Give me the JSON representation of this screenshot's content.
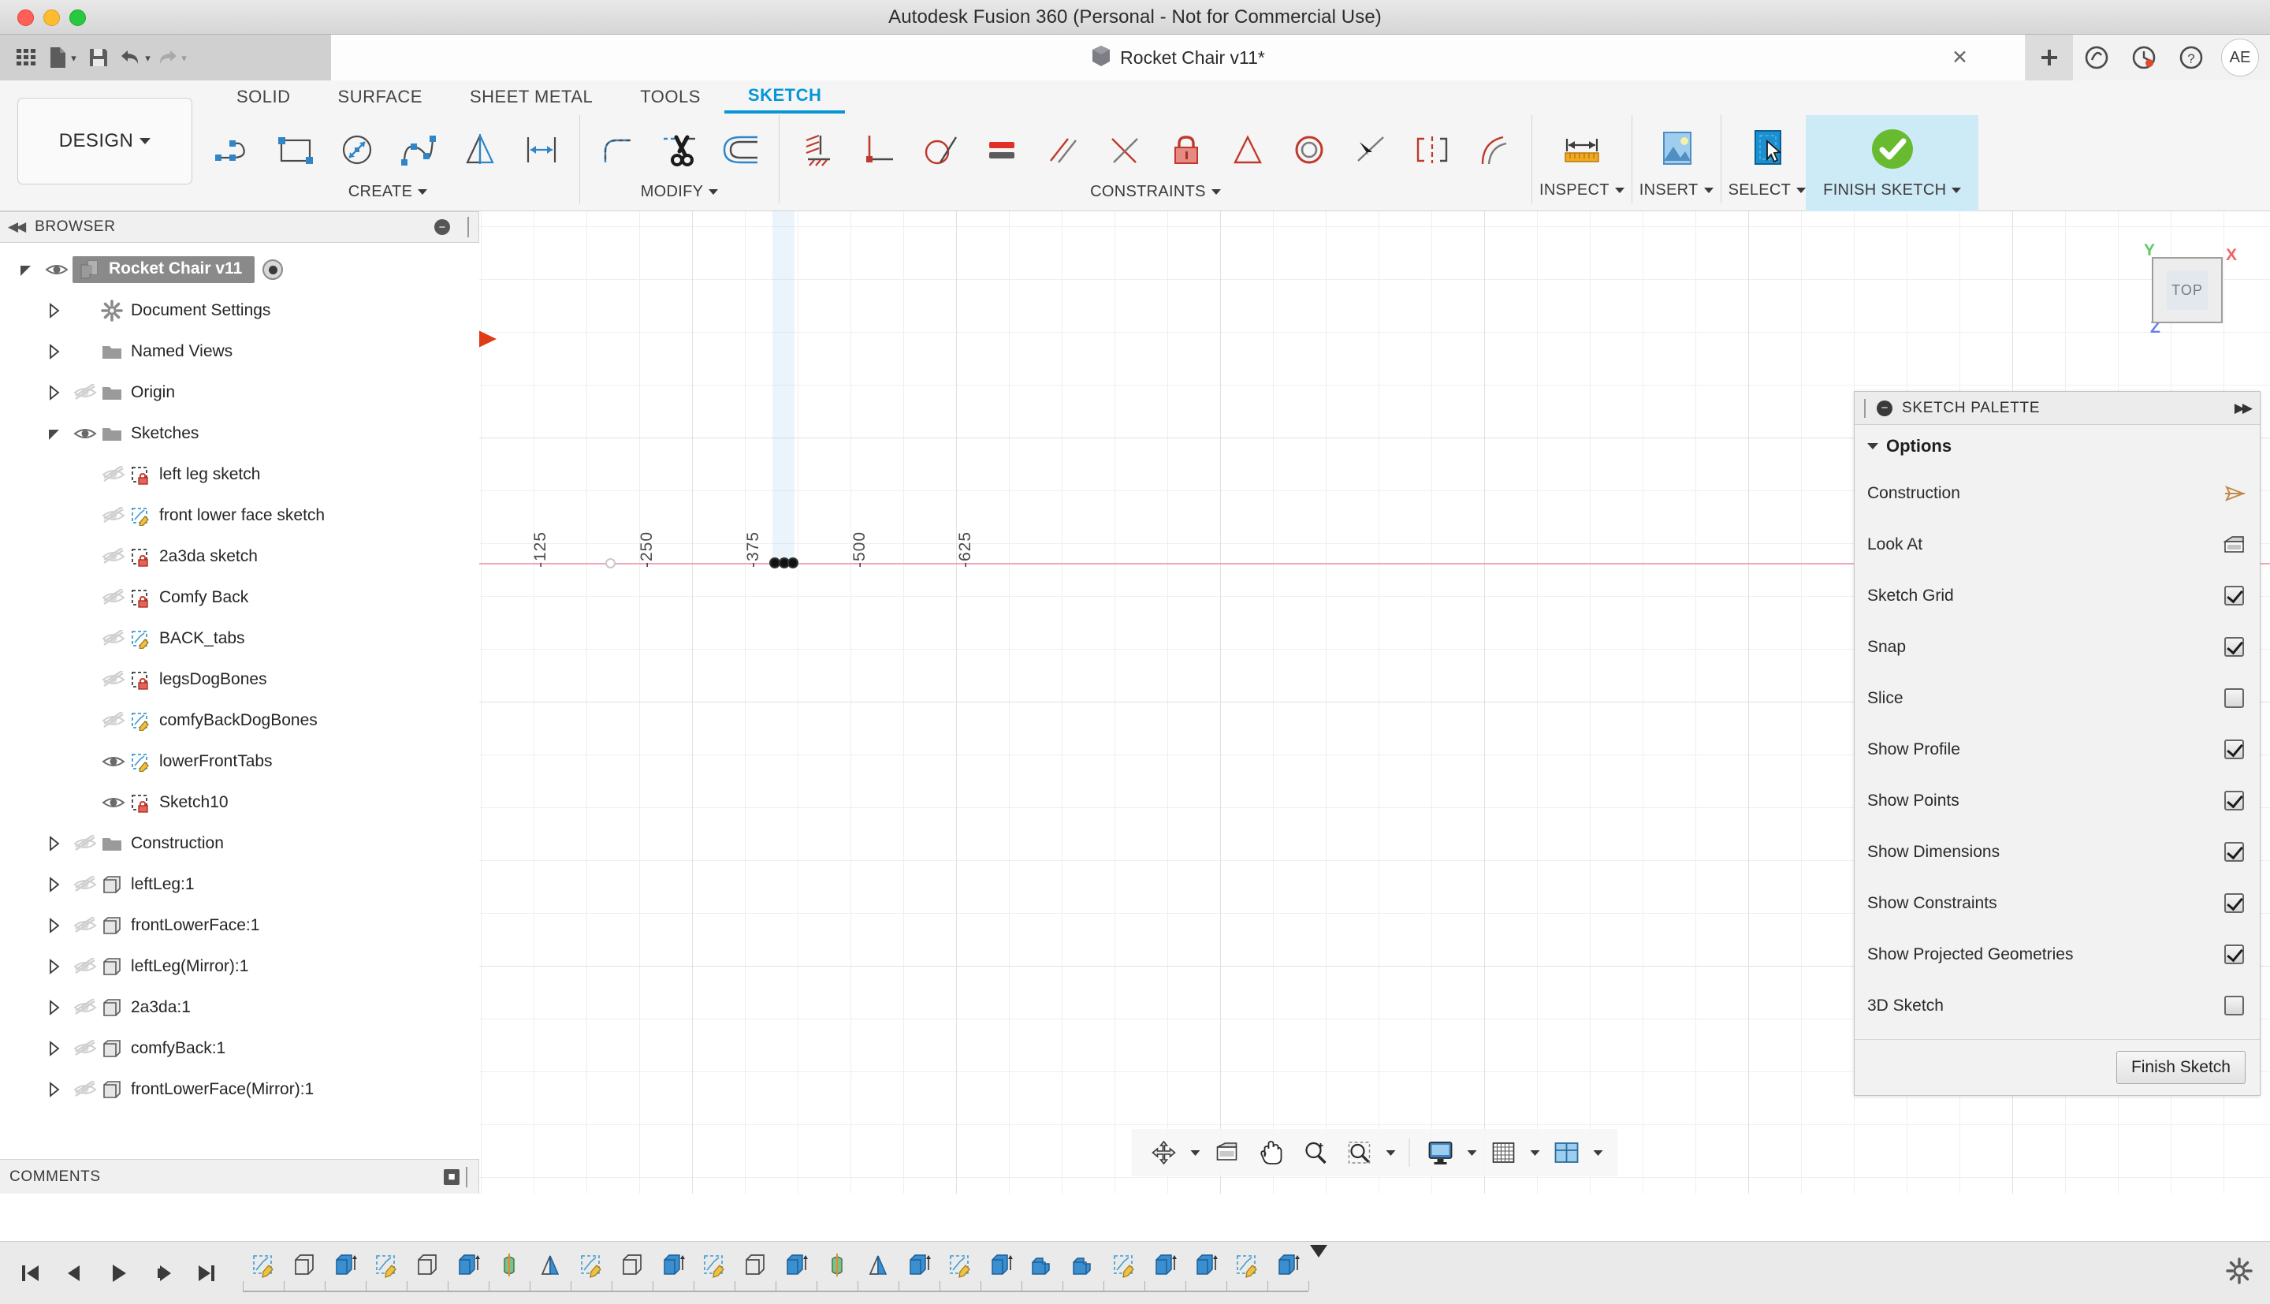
{
  "window": {
    "title": "Autodesk Fusion 360 (Personal - Not for Commercial Use)"
  },
  "quick_access": {
    "grid_icon": "app-grid-icon",
    "file_icon": "file-icon",
    "save_icon": "save-icon",
    "undo_icon": "undo-icon",
    "redo_icon": "redo-icon",
    "caret": "▾"
  },
  "doc_tab": {
    "title": "Rocket Chair v11*",
    "cube_icon": "document-cube-icon",
    "close": "✕",
    "new_tab": "+",
    "help_icon": "help-icon",
    "job_status_icon": "job-status-icon",
    "question_icon": "question-icon",
    "avatar_initials": "AE"
  },
  "ribbon": {
    "design_button": "DESIGN",
    "workspace_tabs": [
      {
        "label": "SOLID",
        "active": false
      },
      {
        "label": "SURFACE",
        "active": false
      },
      {
        "label": "SHEET METAL",
        "active": false
      },
      {
        "label": "TOOLS",
        "active": false
      },
      {
        "label": "SKETCH",
        "active": true
      }
    ],
    "groups": [
      {
        "label": "CREATE",
        "has_caret": true,
        "tools": [
          {
            "name": "line-tool-icon"
          },
          {
            "name": "rectangle-tool-icon"
          },
          {
            "name": "circle-tool-icon"
          },
          {
            "name": "spline-tool-icon"
          },
          {
            "name": "mirror-tool-icon"
          },
          {
            "name": "rectangular-pattern-tool-icon"
          }
        ]
      },
      {
        "label": "MODIFY",
        "has_caret": true,
        "tools": [
          {
            "name": "fillet-tool-icon"
          },
          {
            "name": "trim-tool-icon"
          },
          {
            "name": "offset-tool-icon"
          }
        ]
      },
      {
        "label": "CONSTRAINTS",
        "has_caret": true,
        "tools": [
          {
            "name": "sketch-dimension-icon"
          },
          {
            "name": "horizontal-vertical-constraint-icon"
          },
          {
            "name": "tangent-constraint-icon"
          },
          {
            "name": "equal-constraint-icon"
          },
          {
            "name": "parallel-constraint-icon"
          },
          {
            "name": "perpendicular-constraint-icon"
          },
          {
            "name": "fix-unfix-constraint-icon"
          },
          {
            "name": "midpoint-constraint-icon"
          },
          {
            "name": "concentric-constraint-icon"
          },
          {
            "name": "coincident-constraint-icon"
          },
          {
            "name": "symmetry-constraint-icon"
          },
          {
            "name": "curvature-constraint-icon"
          }
        ]
      }
    ],
    "right_groups": [
      {
        "label": "INSPECT",
        "icon": "measure-icon",
        "has_caret": true,
        "highlight": false
      },
      {
        "label": "INSERT",
        "icon": "insert-image-icon",
        "has_caret": true,
        "highlight": false
      },
      {
        "label": "SELECT",
        "icon": "select-cursor-icon",
        "has_caret": true,
        "highlight": false
      },
      {
        "label": "FINISH SKETCH",
        "icon": "green-check-icon",
        "has_caret": true,
        "highlight": true
      }
    ]
  },
  "browser": {
    "title": "BROWSER",
    "collapse_icon": "collapse-left-icon",
    "minimize_icon": "minimize-icon",
    "comments_label": "COMMENTS",
    "comments_expand_icon": "expand-icon",
    "nodes": [
      {
        "label": "Rocket Chair v11",
        "indent": 0,
        "arrow": "down",
        "eye": "visible",
        "icon": "component-icon",
        "root": true,
        "radio": true
      },
      {
        "label": "Document Settings",
        "indent": 1,
        "arrow": "right",
        "eye": "none",
        "icon": "gear-icon"
      },
      {
        "label": "Named Views",
        "indent": 1,
        "arrow": "right",
        "eye": "none",
        "icon": "folder-icon"
      },
      {
        "label": "Origin",
        "indent": 1,
        "arrow": "right",
        "eye": "hidden",
        "icon": "folder-icon"
      },
      {
        "label": "Sketches",
        "indent": 1,
        "arrow": "down",
        "eye": "visible",
        "icon": "folder-icon"
      },
      {
        "label": "left leg sketch",
        "indent": 2,
        "arrow": "none",
        "eye": "hidden",
        "icon": "sketch-locked-icon"
      },
      {
        "label": "front lower face sketch",
        "indent": 2,
        "arrow": "none",
        "eye": "hidden",
        "icon": "sketch-edit-icon"
      },
      {
        "label": "2a3da sketch",
        "indent": 2,
        "arrow": "none",
        "eye": "hidden",
        "icon": "sketch-locked-icon"
      },
      {
        "label": "Comfy Back",
        "indent": 2,
        "arrow": "none",
        "eye": "hidden",
        "icon": "sketch-locked-icon"
      },
      {
        "label": "BACK_tabs",
        "indent": 2,
        "arrow": "none",
        "eye": "hidden",
        "icon": "sketch-edit-icon"
      },
      {
        "label": "legsDogBones",
        "indent": 2,
        "arrow": "none",
        "eye": "hidden",
        "icon": "sketch-locked-icon"
      },
      {
        "label": "comfyBackDogBones",
        "indent": 2,
        "arrow": "none",
        "eye": "hidden",
        "icon": "sketch-edit-icon"
      },
      {
        "label": "lowerFrontTabs",
        "indent": 2,
        "arrow": "none",
        "eye": "visible",
        "icon": "sketch-edit-icon"
      },
      {
        "label": "Sketch10",
        "indent": 2,
        "arrow": "none",
        "eye": "visible",
        "icon": "sketch-locked-icon"
      },
      {
        "label": "Construction",
        "indent": 1,
        "arrow": "right",
        "eye": "hidden",
        "icon": "folder-icon"
      },
      {
        "label": "leftLeg:1",
        "indent": 1,
        "arrow": "right",
        "eye": "hidden",
        "icon": "body-icon"
      },
      {
        "label": "frontLowerFace:1",
        "indent": 1,
        "arrow": "right",
        "eye": "hidden",
        "icon": "body-icon"
      },
      {
        "label": "leftLeg(Mirror):1",
        "indent": 1,
        "arrow": "right",
        "eye": "hidden",
        "icon": "body-icon"
      },
      {
        "label": "2a3da:1",
        "indent": 1,
        "arrow": "right",
        "eye": "hidden",
        "icon": "body-icon"
      },
      {
        "label": "comfyBack:1",
        "indent": 1,
        "arrow": "right",
        "eye": "hidden",
        "icon": "body-icon"
      },
      {
        "label": "frontLowerFace(Mirror):1",
        "indent": 1,
        "arrow": "right",
        "eye": "hidden",
        "icon": "body-icon"
      }
    ]
  },
  "canvas": {
    "dimension_labels": [
      "-125",
      "-250",
      "-375",
      "-500",
      "-625"
    ],
    "view_cube": {
      "label": "TOP",
      "axis_x": "X",
      "axis_y": "Y",
      "axis_z": "Z"
    },
    "annotation_arrow": {
      "name": "red-arrow-annotation",
      "color": "#e03a16"
    },
    "colors": {
      "x_axis": "#f0a6b4",
      "y_axis": "#9bd99b",
      "sketch_line": "#8f86d6",
      "selection_band": "#a6cee6"
    }
  },
  "palette": {
    "title": "SKETCH PALETTE",
    "minimize_icon": "minimize-icon",
    "expand_icon": "expand-right-icon",
    "section": "Options",
    "options": [
      {
        "label": "Construction",
        "control": "construction-toggle-icon",
        "checked": null
      },
      {
        "label": "Look At",
        "control": "look-at-icon",
        "checked": null
      },
      {
        "label": "Sketch Grid",
        "control": "checkbox",
        "checked": true
      },
      {
        "label": "Snap",
        "control": "checkbox",
        "checked": true
      },
      {
        "label": "Slice",
        "control": "checkbox",
        "checked": false
      },
      {
        "label": "Show Profile",
        "control": "checkbox",
        "checked": true
      },
      {
        "label": "Show Points",
        "control": "checkbox",
        "checked": true
      },
      {
        "label": "Show Dimensions",
        "control": "checkbox",
        "checked": true
      },
      {
        "label": "Show Constraints",
        "control": "checkbox",
        "checked": true
      },
      {
        "label": "Show Projected Geometries",
        "control": "checkbox",
        "checked": true
      },
      {
        "label": "3D Sketch",
        "control": "checkbox",
        "checked": false
      }
    ],
    "finish_button": "Finish Sketch"
  },
  "navbar": {
    "buttons": [
      {
        "name": "orbit-icon",
        "caret": true
      },
      {
        "name": "look-at-icon",
        "caret": false
      },
      {
        "name": "pan-icon",
        "caret": false
      },
      {
        "name": "zoom-icon",
        "caret": false
      },
      {
        "name": "zoom-window-icon",
        "caret": true
      },
      {
        "name": "display-settings-icon",
        "caret": true
      },
      {
        "name": "grid-snaps-icon",
        "caret": true
      },
      {
        "name": "viewports-icon",
        "caret": true
      }
    ]
  },
  "timeline": {
    "playback": [
      {
        "name": "jump-start-icon"
      },
      {
        "name": "step-back-icon"
      },
      {
        "name": "play-icon"
      },
      {
        "name": "step-forward-icon"
      },
      {
        "name": "jump-end-icon"
      }
    ],
    "features": [
      "sketch-feature",
      "body-feature",
      "extrude-feature",
      "sketch-feature",
      "body-feature",
      "extrude-feature",
      "revolve-feature",
      "mirror-feature",
      "sketch-feature",
      "body-feature",
      "extrude-feature",
      "sketch-feature",
      "body-feature",
      "extrude-feature",
      "revolve-feature",
      "mirror-feature",
      "extrude-feature",
      "sketch-feature",
      "extrude-feature",
      "combine-feature",
      "combine-feature",
      "sketch-feature",
      "extrude-feature",
      "extrude-feature",
      "sketch-feature",
      "extrude-feature"
    ],
    "settings_icon": "gear-icon"
  }
}
